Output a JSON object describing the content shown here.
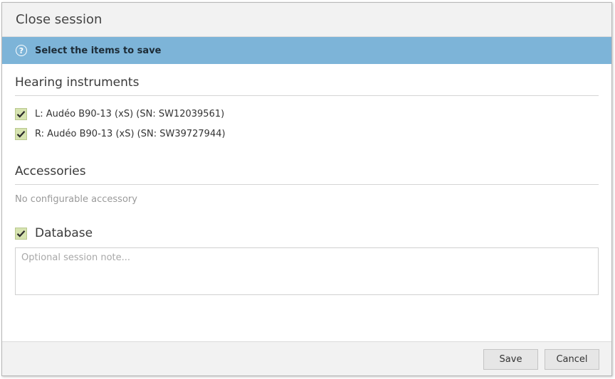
{
  "dialog": {
    "title": "Close session",
    "info_message": "Select the items to save",
    "info_icon": "question-circle-icon"
  },
  "hearing_instruments": {
    "heading": "Hearing instruments",
    "items": [
      {
        "label": "L: Audéo B90-13 (xS) (SN: SW12039561)",
        "checked": true
      },
      {
        "label": "R: Audéo B90-13 (xS) (SN: SW39727944)",
        "checked": true
      }
    ]
  },
  "accessories": {
    "heading": "Accessories",
    "empty_text": "No configurable accessory"
  },
  "database": {
    "label": "Database",
    "checked": true,
    "note_placeholder": "Optional session note...",
    "note_value": ""
  },
  "footer": {
    "save_label": "Save",
    "cancel_label": "Cancel"
  },
  "colors": {
    "info_bar": "#7db4d8",
    "checkbox_fill": "#d6e3b0",
    "checkmark": "#2b2b2b"
  }
}
